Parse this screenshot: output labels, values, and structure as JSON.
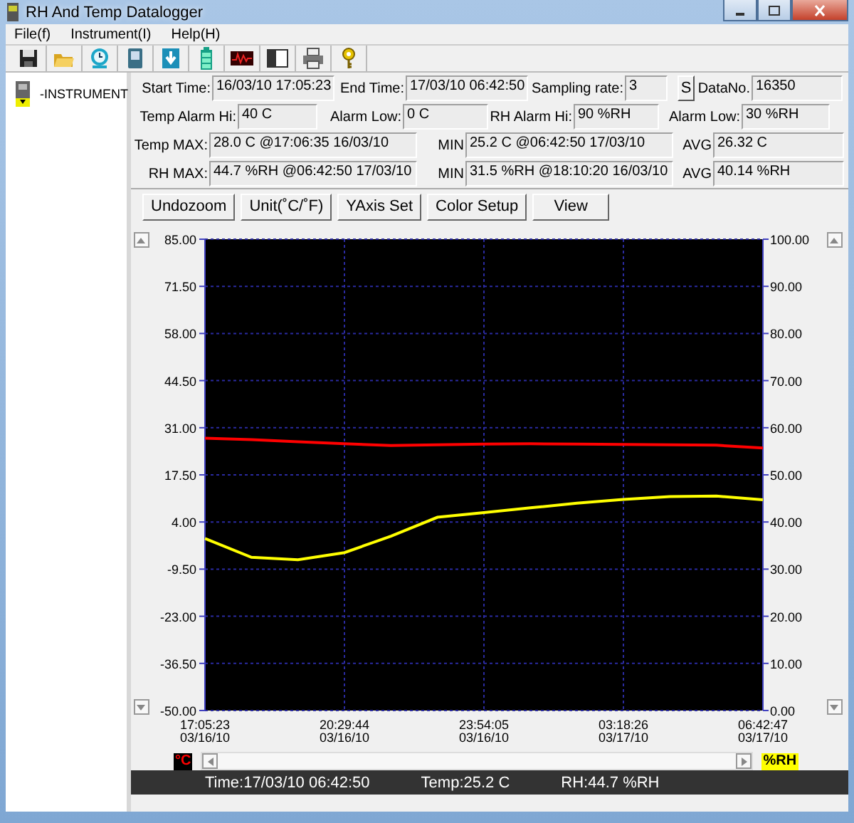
{
  "window": {
    "title": "RH And Temp Datalogger"
  },
  "menu": [
    "File(f)",
    "Instrument(I)",
    "Help(H)"
  ],
  "tree": {
    "label": "-INSTRUMENT"
  },
  "info_rows": [
    [
      {
        "kind": "label",
        "text": "Start Time:"
      },
      {
        "kind": "field",
        "value": "16/03/10 17:05:23"
      },
      {
        "kind": "label",
        "text": "End Time:"
      },
      {
        "kind": "field",
        "value": "17/03/10 06:42:50"
      },
      {
        "kind": "label",
        "text": "Sampling rate:"
      },
      {
        "kind": "field",
        "value": "3"
      },
      {
        "kind": "button",
        "text": "S"
      },
      {
        "kind": "label",
        "text": "DataNo."
      },
      {
        "kind": "field",
        "value": "16350"
      }
    ],
    [
      {
        "kind": "label",
        "text": "Temp Alarm Hi:"
      },
      {
        "kind": "field",
        "value": "40 C"
      },
      {
        "kind": "label",
        "text": "Alarm Low:"
      },
      {
        "kind": "field",
        "value": "0 C"
      },
      {
        "kind": "label",
        "text": "RH Alarm Hi:"
      },
      {
        "kind": "field",
        "value": "90 %RH"
      },
      {
        "kind": "label",
        "text": "Alarm Low:"
      },
      {
        "kind": "field",
        "value": "30 %RH"
      }
    ],
    [
      {
        "kind": "label",
        "text": "Temp MAX:"
      },
      {
        "kind": "field",
        "value": "28.0 C @17:06:35 16/03/10"
      },
      {
        "kind": "label",
        "text": "MIN"
      },
      {
        "kind": "field",
        "value": "25.2 C @06:42:50 17/03/10"
      },
      {
        "kind": "label",
        "text": "AVG"
      },
      {
        "kind": "field",
        "value": "26.32 C"
      }
    ],
    [
      {
        "kind": "label",
        "text": "RH MAX:"
      },
      {
        "kind": "field",
        "value": "44.7 %RH @06:42:50 17/03/10"
      },
      {
        "kind": "label",
        "text": "MIN"
      },
      {
        "kind": "field",
        "value": "31.5 %RH @18:10:20 16/03/10"
      },
      {
        "kind": "label",
        "text": "AVG"
      },
      {
        "kind": "field",
        "value": "40.14 %RH"
      }
    ]
  ],
  "buttons": [
    "Undozoom",
    "Unit(˚C/˚F)",
    "YAxis Set",
    "Color Setup",
    "View"
  ],
  "chart": {
    "chart_data": {
      "type": "line",
      "grid": true,
      "categories": [
        "17:05:23\n03/16/10",
        null,
        null,
        "20:29:44\n03/16/10",
        null,
        null,
        "23:54:05\n03/16/10",
        null,
        null,
        "03:18:26\n03/17/10",
        null,
        null,
        "06:42:47\n03/17/10"
      ],
      "ylim": [
        -50,
        85
      ],
      "yticks": [
        {
          "value": 85,
          "label": "85.00"
        },
        {
          "value": 71.5,
          "label": "71.50"
        },
        {
          "value": 58,
          "label": "58.00"
        },
        {
          "value": 44.5,
          "label": "44.50"
        },
        {
          "value": 31,
          "label": "31.00"
        },
        {
          "value": 17.5,
          "label": "17.50"
        },
        {
          "value": 4,
          "label": "4.00"
        },
        {
          "value": -9.5,
          "label": "-9.50"
        },
        {
          "value": -23,
          "label": "-23.00"
        },
        {
          "value": -36.5,
          "label": "-36.50"
        },
        {
          "value": -50,
          "label": "-50.00"
        }
      ],
      "y2lim": [
        0,
        100
      ],
      "y2ticks": [
        {
          "value": 100,
          "label": "100.00"
        },
        {
          "value": 90,
          "label": "90.00"
        },
        {
          "value": 80,
          "label": "80.00"
        },
        {
          "value": 70,
          "label": "70.00"
        },
        {
          "value": 60,
          "label": "60.00"
        },
        {
          "value": 50,
          "label": "50.00"
        },
        {
          "value": 40,
          "label": "40.00"
        },
        {
          "value": 30,
          "label": "30.00"
        },
        {
          "value": 20,
          "label": "20.00"
        },
        {
          "value": 10,
          "label": "10.00"
        },
        {
          "value": 0,
          "label": "0.00"
        }
      ],
      "series": [
        {
          "color": "#ff0000",
          "values": [
            28.0,
            27.6,
            27.0,
            26.4,
            25.9,
            26.1,
            26.3,
            26.4,
            26.3,
            26.2,
            26.1,
            26.0,
            25.2
          ]
        },
        {
          "color": "#ffff00",
          "axis": "y2",
          "values": [
            36.5,
            32.5,
            32.0,
            33.5,
            37.0,
            41.0,
            42.0,
            43.0,
            44.0,
            44.8,
            45.4,
            45.5,
            44.7
          ]
        }
      ]
    },
    "legend": [
      {
        "text": "°C"
      },
      {
        "text": "%RH"
      }
    ]
  },
  "status_bar": [
    "Time:17/03/10 06:42:50",
    "Temp:25.2 C",
    "RH:44.7 %RH"
  ]
}
